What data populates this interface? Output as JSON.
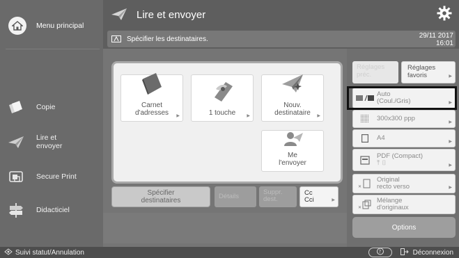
{
  "sidebar": {
    "home_label": "Menu principal",
    "items": [
      {
        "label": "Copie"
      },
      {
        "label_line1": "Lire et",
        "label_line2": "envoyer"
      },
      {
        "label": "Secure Print"
      },
      {
        "label": "Didacticiel"
      }
    ]
  },
  "header": {
    "title": "Lire et envoyer",
    "message": "Spécifier les destinataires.",
    "date": "29/11 2017",
    "time": "16:01"
  },
  "destinations": [
    {
      "line1": "Carnet",
      "line2": "d'adresses",
      "icon": "address-book-icon"
    },
    {
      "line1": "1 touche",
      "line2": "",
      "icon": "one-touch-icon"
    },
    {
      "line1": "Nouv.",
      "line2": "destinataire",
      "icon": "new-destination-icon"
    },
    {
      "line1": "Me",
      "line2": "l'envoyer",
      "icon": "send-to-myself-icon"
    }
  ],
  "action_row": {
    "specify_line1": "Spécifier",
    "specify_line2": "destinataires",
    "details": "Détails",
    "delete_line1": "Suppr.",
    "delete_line2": "dest.",
    "cc_line1": "Cc",
    "cc_line2": "Cci"
  },
  "settings": {
    "prev_line1": "Réglages",
    "prev_line2": "préc.",
    "fav_line1": "Réglages",
    "fav_line2": "favoris",
    "color_line1": "Auto",
    "color_line2": "(Coul./Gris)",
    "resolution": "300x300 ppp",
    "size": "A4",
    "format": "PDF (Compact)",
    "original_line1": "Original",
    "original_line2": "recto verso",
    "mix_line1": "Mélange",
    "mix_line2": "d'originaux",
    "options": "Options"
  },
  "statusbar": {
    "left": "Suivi statut/Annulation",
    "logout": "Déconnexion"
  },
  "colors": {
    "background": "#6f6f6f",
    "panel": "#f0f0f0",
    "highlight_border": "#111111"
  }
}
